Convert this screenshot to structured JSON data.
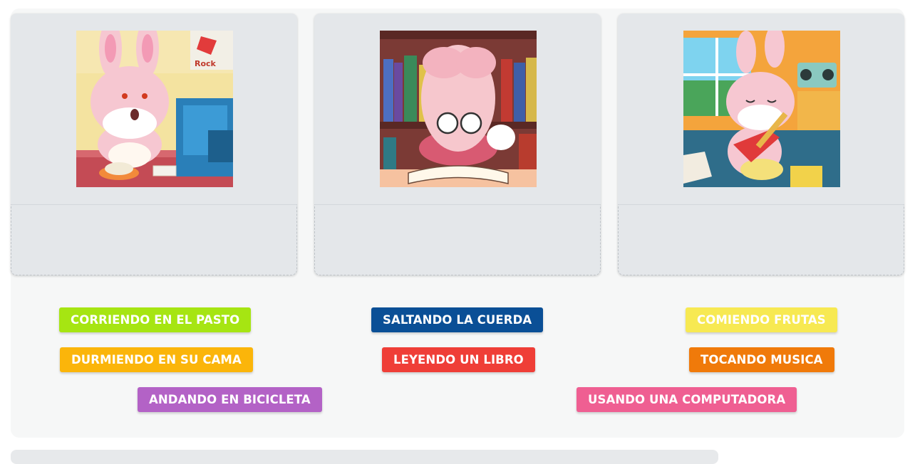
{
  "cards": [
    {
      "illustration": "bunny-using-computer"
    },
    {
      "illustration": "bunny-reading-book"
    },
    {
      "illustration": "bunny-playing-guitar"
    }
  ],
  "chips": [
    {
      "label": "CORRIENDO EN EL PASTO",
      "color": "#a6e512"
    },
    {
      "label": "SALTANDO LA CUERDA",
      "color": "#0a4f96"
    },
    {
      "label": "COMIENDO FRUTAS",
      "color": "#f7e952"
    },
    {
      "label": "DURMIENDO EN SU CAMA",
      "color": "#fbb50a"
    },
    {
      "label": "LEYENDO UN LIBRO",
      "color": "#ef3e37"
    },
    {
      "label": "TOCANDO MUSICA",
      "color": "#f07a0a"
    },
    {
      "label": "ANDANDO EN BICICLETA",
      "color": "#b362c6"
    },
    {
      "label": "USANDO UNA COMPUTADORA",
      "color": "#ef5f92"
    }
  ]
}
